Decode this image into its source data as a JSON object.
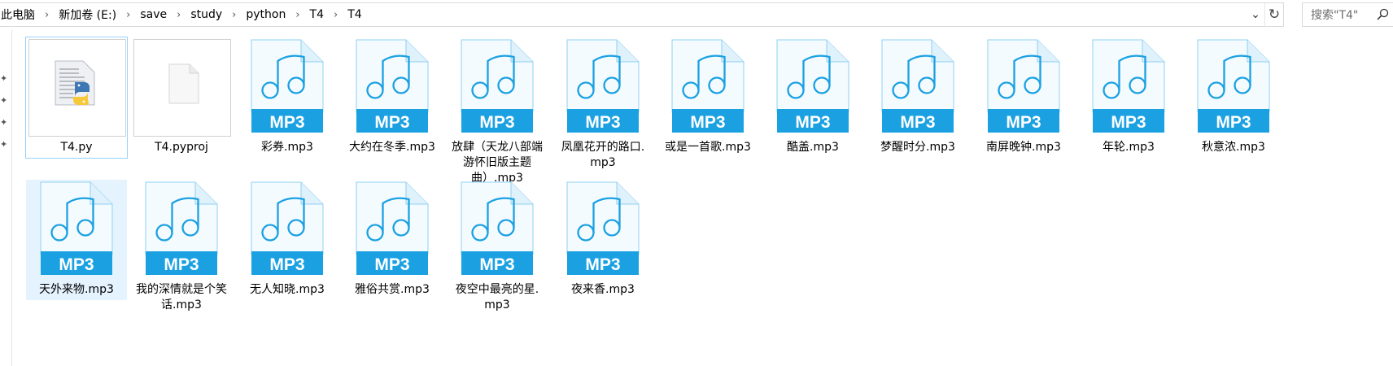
{
  "address": {
    "crumbs": [
      "此电脑",
      "新加卷 (E:)",
      "save",
      "study",
      "python",
      "T4",
      "T4"
    ],
    "separator": "›",
    "dropdown_glyph": "⌄",
    "refresh_glyph": "↻"
  },
  "search": {
    "placeholder": "搜索\"T4\"",
    "icon": "search-icon"
  },
  "files": [
    {
      "name": "T4.py",
      "type": "python"
    },
    {
      "name": "T4.pyproj",
      "type": "blank"
    },
    {
      "name": "彩券.mp3",
      "type": "mp3"
    },
    {
      "name": "大约在冬季.mp3",
      "type": "mp3"
    },
    {
      "name": "放肆（天龙八部端游怀旧版主题曲）.mp3",
      "type": "mp3"
    },
    {
      "name": "凤凰花开的路口.mp3",
      "type": "mp3"
    },
    {
      "name": "或是一首歌.mp3",
      "type": "mp3"
    },
    {
      "name": "酷盖.mp3",
      "type": "mp3"
    },
    {
      "name": "梦醒时分.mp3",
      "type": "mp3"
    },
    {
      "name": "南屏晚钟.mp3",
      "type": "mp3"
    },
    {
      "name": "年轮.mp3",
      "type": "mp3"
    },
    {
      "name": "秋意浓.mp3",
      "type": "mp3"
    },
    {
      "name": "天外来物.mp3",
      "type": "mp3"
    },
    {
      "name": "我的深情就是个笑话.mp3",
      "type": "mp3"
    },
    {
      "name": "无人知晓.mp3",
      "type": "mp3"
    },
    {
      "name": "雅俗共赏.mp3",
      "type": "mp3"
    },
    {
      "name": "夜空中最亮的星.mp3",
      "type": "mp3"
    },
    {
      "name": "夜来香.mp3",
      "type": "mp3"
    }
  ],
  "mp3_badge": "MP3",
  "colors": {
    "mp3_blue": "#1ba1e2",
    "selected_bg": "#e5f3ff",
    "focus_border": "#99d1ff"
  }
}
